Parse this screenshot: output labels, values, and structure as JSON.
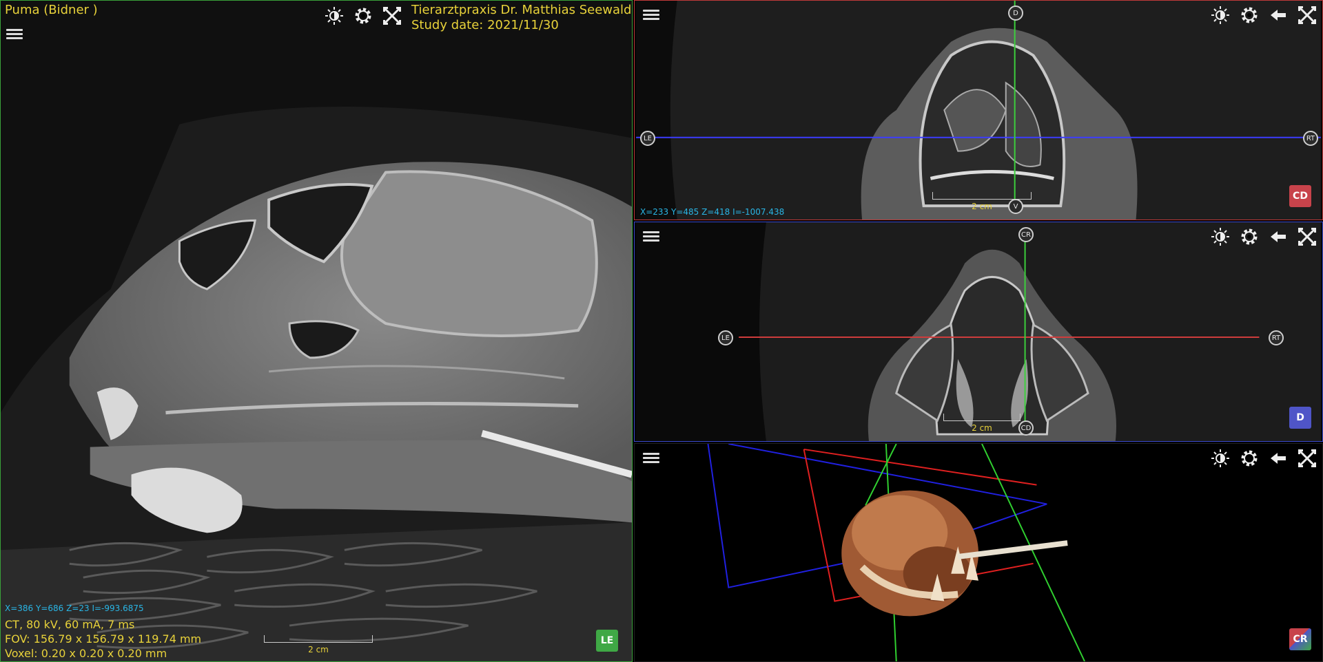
{
  "sagittal": {
    "patient": "Puma (Bidner )",
    "clinic": "Tierarztpraxis Dr. Matthias Seewald",
    "study_date": "Study date: 2021/11/30",
    "coords": "X=386 Y=686 Z=23 I=-993.6875",
    "params": "CT, 80 kV, 60 mA, 7 ms",
    "fov": "FOV: 156.79 x 156.79 x 119.74 mm",
    "voxel": "Voxel: 0.20 x 0.20 x 0.20 mm",
    "scale_label": "2 cm",
    "orientation": "LE"
  },
  "axial": {
    "coords": "X=233 Y=485 Z=418 I=-1007.438",
    "scale_label": "2 cm",
    "marker_top": "D",
    "marker_bottom": "V",
    "marker_left": "LE",
    "marker_right": "RT",
    "orientation": "CD"
  },
  "coronal": {
    "scale_label": "2 cm",
    "marker_top": "CR",
    "marker_bottom": "CD",
    "marker_left": "LE",
    "marker_right": "RT",
    "orientation": "D"
  },
  "render3d": {
    "cube_label": "CR"
  },
  "toolbar_icons": [
    "brightness-icon",
    "settings-gear-icon",
    "back-arrow-icon",
    "fullscreen-toggle-icon"
  ],
  "colors": {
    "overlay_yellow": "#e8d23a",
    "overlay_cyan": "#29b6e6",
    "crosshair_green": "#3ccf3c",
    "crosshair_blue": "#3c3cff",
    "crosshair_red": "#d03c3c"
  }
}
